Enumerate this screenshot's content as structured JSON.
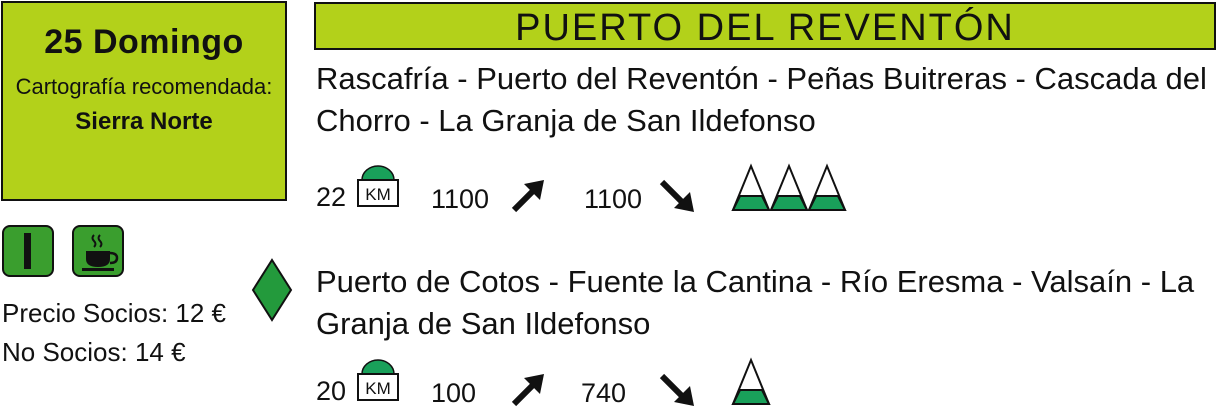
{
  "excursion": {
    "date": "25 Domingo",
    "cartography_label": "Cartografía recomendada:",
    "cartography_value": "Sierra Norte",
    "price_members": "Precio Socios: 12 €",
    "price_non_members": "No Socios: 14 €",
    "title": "PUERTO DEL REVENTÓN"
  },
  "icons": [
    "level-I-icon",
    "coffee-cup-icon",
    "diamond-icon",
    "km-icon",
    "ascent-arrow-icon",
    "descent-arrow-icon",
    "mountain-icon"
  ],
  "routes": [
    {
      "description": "Rascafría - Puerto del Reventón - Peñas Buitreras - Cascada del Chorro - La Granja de San Ildefonso",
      "distance": "22",
      "km_label": "KM",
      "ascent": "1100",
      "descent": "1100",
      "difficulty": 3
    },
    {
      "description": "Puerto de Cotos - Fuente la Cantina - Río Eresma - Valsaín - La Granja de San Ildefonso",
      "distance": "20",
      "km_label": "KM",
      "ascent": "100",
      "descent": "740",
      "difficulty": 1
    }
  ],
  "colors": {
    "header_bg": "#b3d11a",
    "icon_green": "#3a9e2e",
    "mountain_green": "#19a05a",
    "diamond_green": "#239a3c"
  }
}
